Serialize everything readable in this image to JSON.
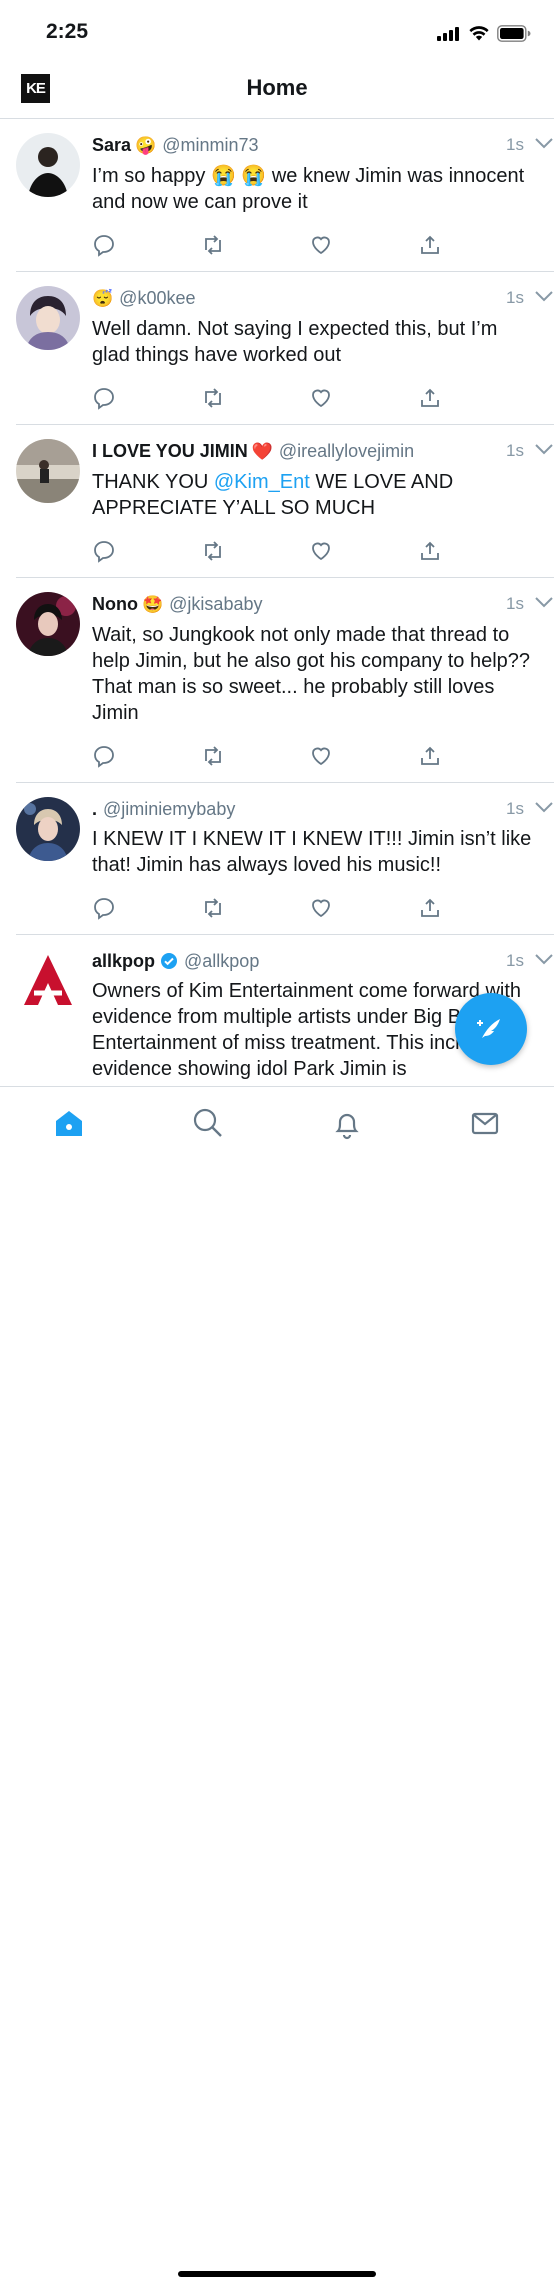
{
  "status_bar": {
    "time": "2:25"
  },
  "header": {
    "logo_text": "KE",
    "title": "Home"
  },
  "colors": {
    "accent": "#1da1f2",
    "muted": "#657786",
    "verified": "#1da1f2",
    "heart_red": "#e0245e"
  },
  "tweets": [
    {
      "name": "Sara",
      "emoji": "🤪",
      "handle": "@minmin73",
      "time": "1s",
      "text": "I’m so happy 😭 😭  we knew Jimin was innocent and now we can prove it"
    },
    {
      "name": "",
      "emoji": "😴",
      "handle": "@k00kee",
      "time": "1s",
      "text": "Well damn. Not saying I expected this, but I’m glad things have worked out"
    },
    {
      "name": "I LOVE YOU JIMIN",
      "emoji": "❤️",
      "handle": "@ireallylovejimin",
      "time": "1s",
      "text_pre": "THANK YOU ",
      "mention": "@Kim_Ent",
      "text_post": " WE LOVE AND APPRECIATE Y’ALL SO MUCH"
    },
    {
      "name": "Nono",
      "emoji": "🤩",
      "handle": "@jkisababy",
      "time": "1s",
      "text": "Wait, so Jungkook not only made that thread to help Jimin, but he also got his company to help?? That man is so sweet... he probably still loves Jimin"
    },
    {
      "name": ".",
      "emoji": "",
      "handle": "@jiminiemybaby",
      "time": "1s",
      "text": "I KNEW IT I KNEW IT I KNEW IT!!! Jimin isn’t like that! Jimin has always loved his music!!"
    },
    {
      "name": "allkpop",
      "emoji": "",
      "handle": "@allkpop",
      "time": "1s",
      "verified": true,
      "text": "Owners of Kim Entertainment come forward with evidence from multiple artists under Big Bay Entertainment of miss treatment. This includes evidence showing idol Park Jimin is"
    }
  ]
}
